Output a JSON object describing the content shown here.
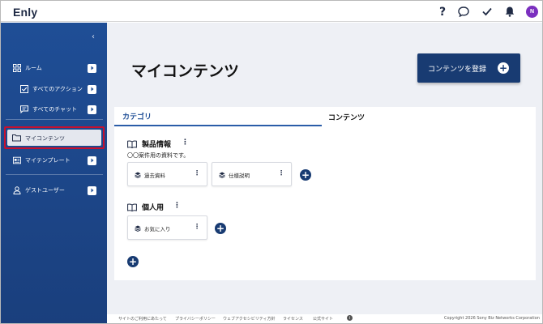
{
  "app": {
    "logo": "Enly",
    "avatar_initial": "N"
  },
  "header": {
    "icons": [
      "help-icon",
      "chat-icon",
      "check-icon",
      "bell-icon"
    ]
  },
  "sidebar": {
    "collapse_glyph": "‹",
    "items": [
      {
        "label": "ルーム",
        "icon": "grid-icon"
      },
      {
        "label": "すべてのアクション",
        "icon": "checkbox-icon"
      },
      {
        "label": "すべてのチャット",
        "icon": "chat-icon"
      },
      {
        "label": "マイコンテンツ",
        "icon": "folder-icon",
        "active": true
      },
      {
        "label": "マイテンプレート",
        "icon": "template-icon"
      },
      {
        "label": "ゲストユーザー",
        "icon": "person-icon"
      }
    ]
  },
  "main": {
    "title": "マイコンテンツ",
    "register_button": "コンテンツを登録",
    "tabs": {
      "category": "カテゴリ",
      "contents": "コンテンツ"
    },
    "groups": [
      {
        "title": "製品情報",
        "description": "〇〇案件用の資料です。",
        "cards": [
          "過去資料",
          "仕様説明"
        ]
      },
      {
        "title": "個人用",
        "cards": [
          "お気に入り"
        ]
      }
    ]
  },
  "footer": {
    "links": [
      "サイトのご利用にあたって",
      "プライバシーポリシー",
      "ウェブアクセシビリティ方針",
      "ライセンス",
      "公式サイト"
    ],
    "copyright": "Copyright 2026 Sony Biz Networks Corporation"
  },
  "colors": {
    "sidebar": "#1f4e96",
    "primary_button": "#183b72",
    "highlight_border": "#c8102e",
    "main_bg": "#eef0f5"
  }
}
